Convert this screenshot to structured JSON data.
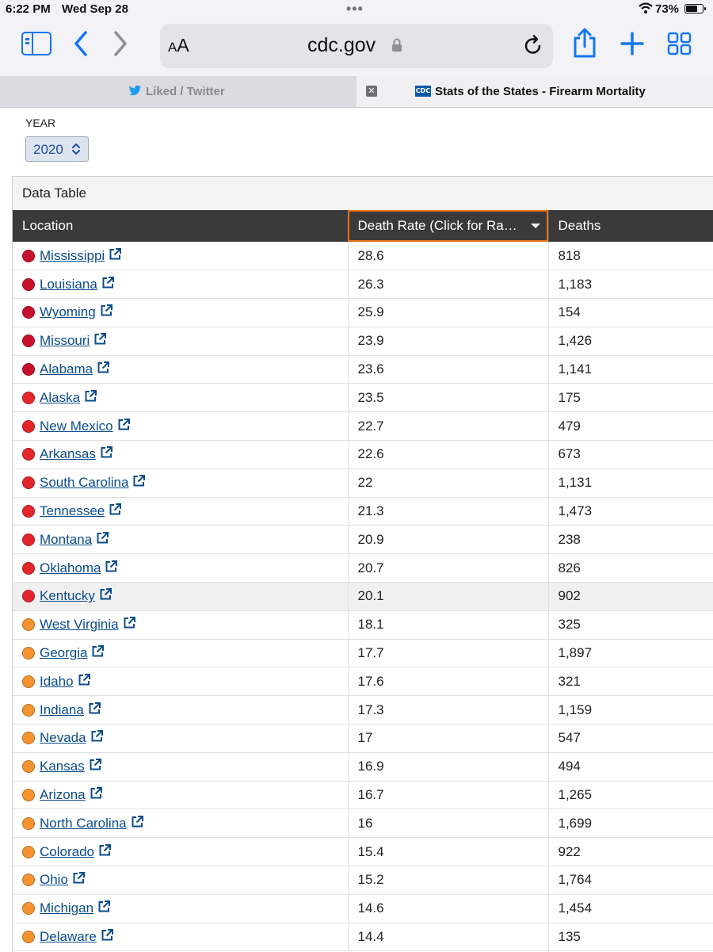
{
  "status_bar": {
    "time": "6:22 PM",
    "date": "Wed Sep 28",
    "battery": "73%",
    "battery_level": 0.73
  },
  "toolbar": {
    "text_size_label": "AA",
    "domain": "cdc.gov"
  },
  "tabs": [
    {
      "label": "Liked / Twitter",
      "active": false,
      "icon": "twitter-bird-icon"
    },
    {
      "label": "Stats of the States - Firearm Mortality",
      "active": true,
      "icon": "cdc-favicon"
    }
  ],
  "filter": {
    "label": "YEAR",
    "selected": "2020"
  },
  "table": {
    "caption": "Data Table",
    "columns": [
      "Location",
      "Death Rate (Click for Ra…",
      "Deaths"
    ],
    "sorted_column": 1,
    "colors": {
      "high": "#c8102e",
      "upper": "#e3262b",
      "mid": "#f59331"
    },
    "rows": [
      {
        "location": "Mississippi",
        "rate": "28.6",
        "deaths": "818",
        "tier": "high"
      },
      {
        "location": "Louisiana",
        "rate": "26.3",
        "deaths": "1,183",
        "tier": "high"
      },
      {
        "location": "Wyoming",
        "rate": "25.9",
        "deaths": "154",
        "tier": "high"
      },
      {
        "location": "Missouri",
        "rate": "23.9",
        "deaths": "1,426",
        "tier": "high"
      },
      {
        "location": "Alabama",
        "rate": "23.6",
        "deaths": "1,141",
        "tier": "high"
      },
      {
        "location": "Alaska",
        "rate": "23.5",
        "deaths": "175",
        "tier": "upper"
      },
      {
        "location": "New Mexico",
        "rate": "22.7",
        "deaths": "479",
        "tier": "upper"
      },
      {
        "location": "Arkansas",
        "rate": "22.6",
        "deaths": "673",
        "tier": "upper"
      },
      {
        "location": "South Carolina",
        "rate": "22",
        "deaths": "1,131",
        "tier": "upper"
      },
      {
        "location": "Tennessee",
        "rate": "21.3",
        "deaths": "1,473",
        "tier": "upper"
      },
      {
        "location": "Montana",
        "rate": "20.9",
        "deaths": "238",
        "tier": "upper"
      },
      {
        "location": "Oklahoma",
        "rate": "20.7",
        "deaths": "826",
        "tier": "upper"
      },
      {
        "location": "Kentucky",
        "rate": "20.1",
        "deaths": "902",
        "tier": "upper",
        "highlighted": true
      },
      {
        "location": "West Virginia",
        "rate": "18.1",
        "deaths": "325",
        "tier": "mid"
      },
      {
        "location": "Georgia",
        "rate": "17.7",
        "deaths": "1,897",
        "tier": "mid"
      },
      {
        "location": "Idaho",
        "rate": "17.6",
        "deaths": "321",
        "tier": "mid"
      },
      {
        "location": "Indiana",
        "rate": "17.3",
        "deaths": "1,159",
        "tier": "mid"
      },
      {
        "location": "Nevada",
        "rate": "17",
        "deaths": "547",
        "tier": "mid"
      },
      {
        "location": "Kansas",
        "rate": "16.9",
        "deaths": "494",
        "tier": "mid"
      },
      {
        "location": "Arizona",
        "rate": "16.7",
        "deaths": "1,265",
        "tier": "mid"
      },
      {
        "location": "North Carolina",
        "rate": "16",
        "deaths": "1,699",
        "tier": "mid"
      },
      {
        "location": "Colorado",
        "rate": "15.4",
        "deaths": "922",
        "tier": "mid"
      },
      {
        "location": "Ohio",
        "rate": "15.2",
        "deaths": "1,764",
        "tier": "mid"
      },
      {
        "location": "Michigan",
        "rate": "14.6",
        "deaths": "1,454",
        "tier": "mid"
      },
      {
        "location": "Delaware",
        "rate": "14.4",
        "deaths": "135",
        "tier": "mid"
      }
    ]
  }
}
